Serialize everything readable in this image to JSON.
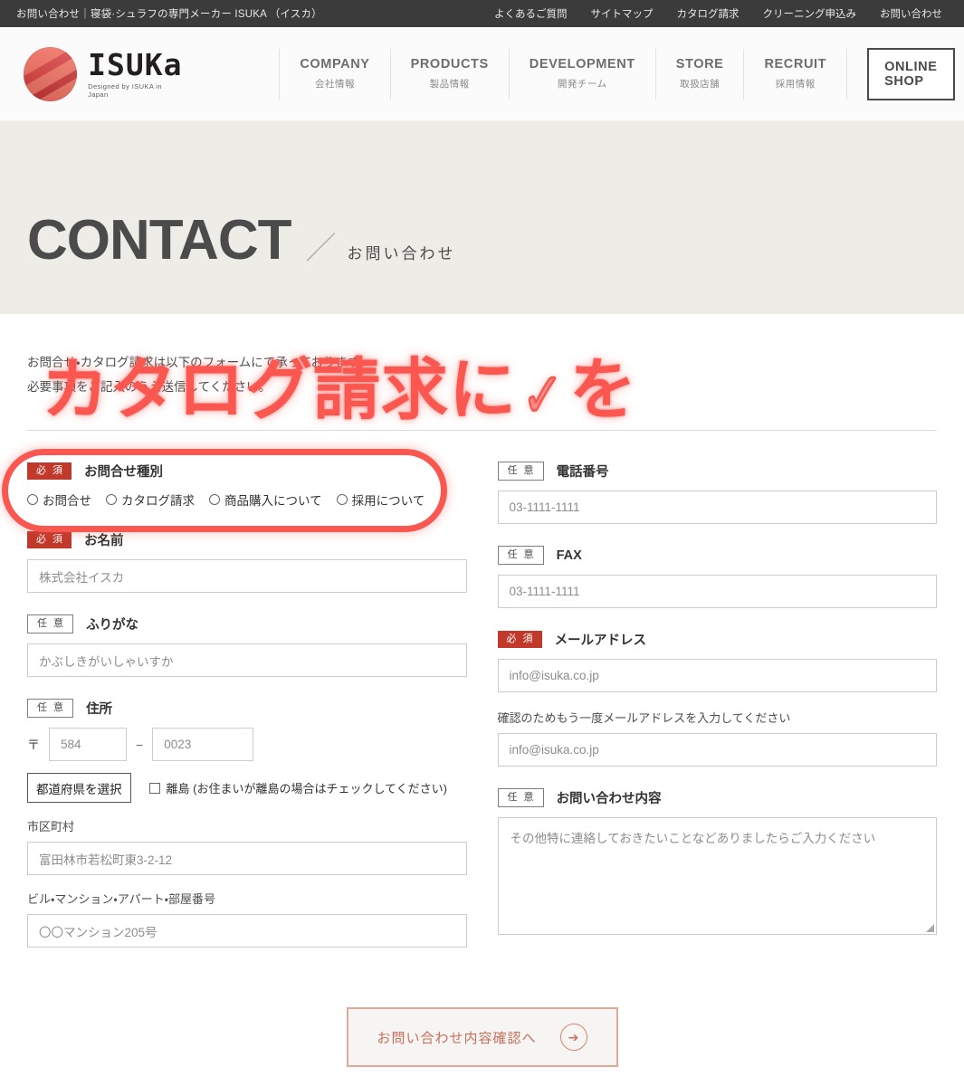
{
  "topbar": {
    "title": "お問い合わせ｜寝袋·シュラフの専門メーカー ISUKA （イスカ）",
    "links": [
      "よくあるご質問",
      "サイトマップ",
      "カタログ請求",
      "クリーニング申込み",
      "お問い合わせ"
    ]
  },
  "header": {
    "logo_word": "ISUKa",
    "logo_tagline": "Designed by ISUKA in Japan",
    "nav": [
      {
        "en": "COMPANY",
        "ja": "会社情報"
      },
      {
        "en": "PRODUCTS",
        "ja": "製品情報"
      },
      {
        "en": "DEVELOPMENT",
        "ja": "開発チーム"
      },
      {
        "en": "STORE",
        "ja": "取扱店舗"
      },
      {
        "en": "RECRUIT",
        "ja": "採用情報"
      }
    ],
    "shop_button": "ONLINE SHOP"
  },
  "hero": {
    "title_en": "CONTACT",
    "separator": "／",
    "title_ja": "お問い合わせ"
  },
  "intro": {
    "line1": "お問合せ・カタログ請求は以下のフォームにて承っております。",
    "line2": "必要事項をご記入のうえ送信してください。"
  },
  "badges": {
    "required": "必 須",
    "optional": "任 意"
  },
  "form": {
    "inquiry_type": {
      "label": "お問合せ種別",
      "options": [
        "お問合せ",
        "カタログ請求",
        "商品購入について",
        "採用について"
      ]
    },
    "name": {
      "label": "お名前",
      "placeholder": "株式会社イスカ"
    },
    "furigana": {
      "label": "ふりがな",
      "placeholder": "かぶしきがいしゃいすか"
    },
    "address": {
      "label": "住所",
      "zip_mark": "〒",
      "zip1": "584",
      "zip_dash": "−",
      "zip2": "0023",
      "prefecture_select": "都道府県を選択",
      "island_checkbox": "離島 (お住まいが離島の場合はチェックしてください)",
      "city_label": "市区町村",
      "city_placeholder": "富田林市若松町東3-2-12",
      "building_label": "ビル・マンション・アパート・部屋番号",
      "building_placeholder": "〇〇マンション205号"
    },
    "tel": {
      "label": "電話番号",
      "placeholder": "03-1111-1111"
    },
    "fax": {
      "label": "FAX",
      "placeholder": "03-1111-1111"
    },
    "email": {
      "label": "メールアドレス",
      "placeholder": "info@isuka.co.jp",
      "confirm_label": "確認のためもう一度メールアドレスを入力してください",
      "confirm_placeholder": "info@isuka.co.jp"
    },
    "message": {
      "label": "お問い合わせ内容",
      "placeholder": "その他特に連絡しておきたいことなどありましたらご入力ください"
    },
    "submit": {
      "label": "お問い合わせ内容確認へ",
      "arrow": "➔"
    }
  },
  "annotation": {
    "text_before": "カタログ請求に",
    "check": "✓",
    "text_after": "を",
    "color": "#f9574f"
  }
}
